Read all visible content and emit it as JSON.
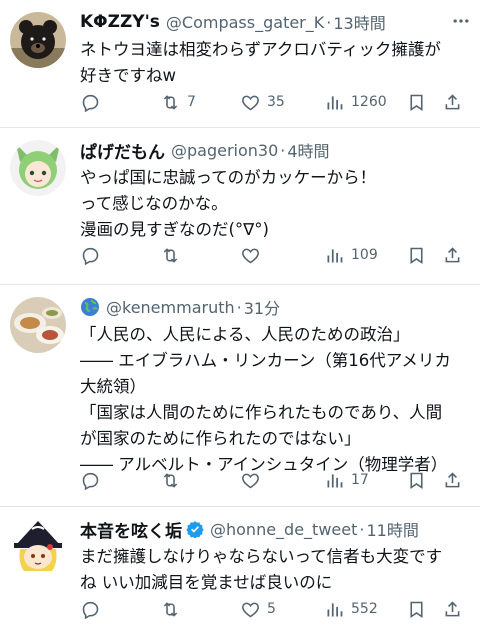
{
  "tweets": [
    {
      "name": "KΦZZY's",
      "handle": "@Compass_gater_K",
      "time": "13時間",
      "lines": [
        "ネトウヨ達は相変わらずアクロバティック擁護が",
        "好きですねw"
      ],
      "reply_count": "",
      "retweet_count": "7",
      "like_count": "35",
      "view_count": "1260",
      "avatar": "bear-avatar"
    },
    {
      "name": "ぱげだもん",
      "handle": "@pagerion30",
      "time": "4時間",
      "lines": [
        "やっぱ国に忠誠ってのがカッケーから！",
        "って感じなのかな。",
        "漫画の見すぎなのだ(°∇°)"
      ],
      "reply_count": "",
      "retweet_count": "",
      "like_count": "",
      "view_count": "109",
      "avatar": "anime-girl-avatar"
    },
    {
      "name": "",
      "handle": "@kenemmaruth",
      "time": "31分",
      "lines": [
        "「人民の、人民による、人民のための政治」",
        "―― エイブラハム・リンカーン（第16代アメリカ",
        "大統領）",
        "「国家は人間のために作られたものであり、人間",
        "が国家のために作られたのではない」",
        "―― アルベルト・アインシュタイン（物理学者）"
      ],
      "reply_count": "",
      "retweet_count": "",
      "like_count": "",
      "view_count": "17",
      "avatar": "food-plate-avatar"
    },
    {
      "name": "本音を呟く垢",
      "handle": "@honne_de_tweet",
      "time": "11時間",
      "lines": [
        "まだ擁護しなけりゃならないって信者も大変です",
        "ね いい加減目を覚ませば良いのに"
      ],
      "reply_count": "",
      "retweet_count": "",
      "like_count": "5",
      "view_count": "552",
      "avatar": "witch-avatar"
    }
  ],
  "colors": {
    "text": "#0f1419",
    "secondary": "#536471",
    "verified": "#1d9bf0",
    "divider": "#e3e6e8"
  }
}
